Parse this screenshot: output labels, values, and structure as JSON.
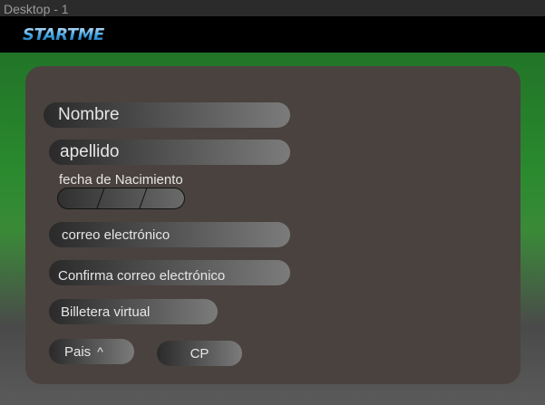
{
  "canvas": {
    "title": "Desktop - 1"
  },
  "header": {
    "logo_text": "STARTME"
  },
  "form": {
    "nombre_placeholder": "Nombre",
    "apellido_placeholder": "apellido",
    "fecha_label": "fecha de Nacimiento",
    "correo_placeholder": "correo electrónico",
    "confirma_correo_placeholder": "Confirma correo electrónico",
    "billetera_placeholder": "Billetera virtual",
    "pais_label": "Pais",
    "pais_chevron": "^",
    "cp_placeholder": "CP"
  },
  "colors": {
    "frame_green": "#2a8a2e",
    "card": "#4a423e",
    "topbar": "#000000",
    "logo_blue": "#3aa0e0"
  }
}
